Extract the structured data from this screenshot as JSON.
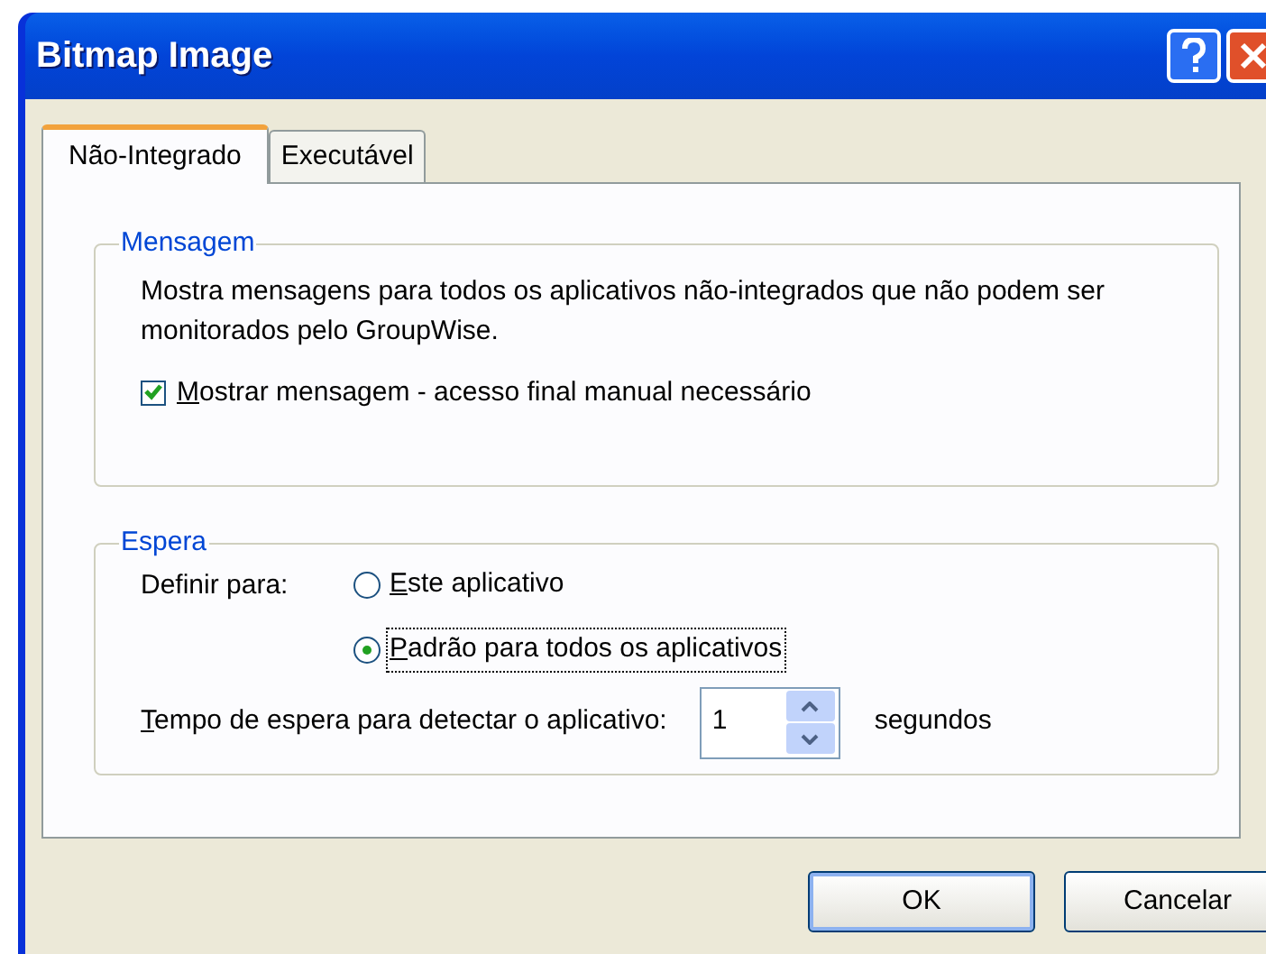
{
  "window": {
    "title": "Bitmap Image"
  },
  "tabs": [
    {
      "label": "Não-Integrado",
      "selected": true
    },
    {
      "label": "Executável",
      "selected": false
    }
  ],
  "mensagem": {
    "title": "Mensagem",
    "description": "Mostra mensagens para todos os aplicativos não-integrados que não podem ser monitorados pelo GroupWise.",
    "checkbox": {
      "label": "Mostrar mensagem - acesso final manual necessário",
      "checked": true
    }
  },
  "espera": {
    "title": "Espera",
    "define_label": "Definir para:",
    "options": [
      {
        "label": "Este aplicativo",
        "selected": false
      },
      {
        "label": "Padrão para todos os aplicativos",
        "selected": true
      }
    ],
    "timeout_label": "Tempo de espera para detectar o aplicativo:",
    "timeout_value": "1",
    "unit": "segundos"
  },
  "buttons": [
    {
      "label": "OK",
      "default": true
    },
    {
      "label": "Cancelar",
      "default": false
    }
  ]
}
